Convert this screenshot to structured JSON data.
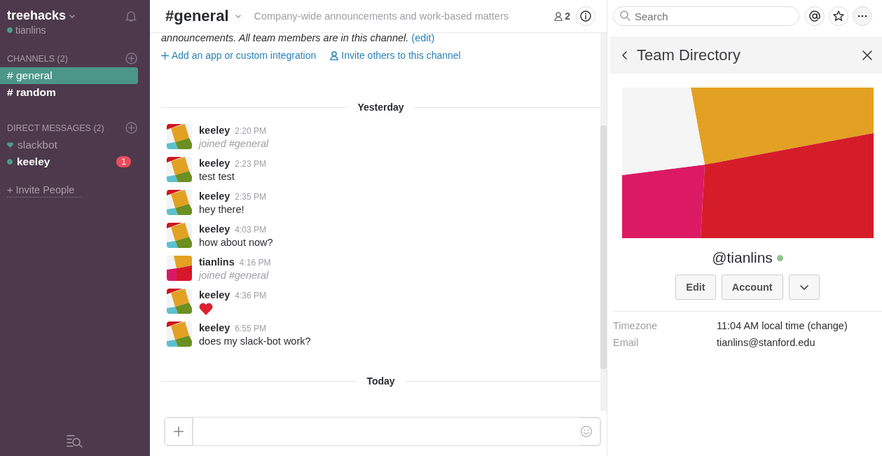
{
  "team": {
    "name": "treehacks",
    "user": "tianlins",
    "online": true
  },
  "channels_section": {
    "title": "CHANNELS",
    "count": "(2)"
  },
  "channels": [
    {
      "prefix": "#",
      "name": "general",
      "selected": true,
      "unread": false
    },
    {
      "prefix": "#",
      "name": "random",
      "selected": false,
      "unread": true
    }
  ],
  "dm_section": {
    "title": "DIRECT MESSAGES",
    "count": "(2)"
  },
  "direct_messages": [
    {
      "name": "slackbot",
      "kind": "bot",
      "unread": false
    },
    {
      "name": "keeley",
      "kind": "user",
      "unread": true,
      "badge": "1"
    }
  ],
  "invite": {
    "icon": "+",
    "label": "Invite People"
  },
  "header": {
    "channel": "#general",
    "topic": "Company-wide announcements and work-based matters",
    "members": "2",
    "search_placeholder": "Search"
  },
  "intro": {
    "text": "announcements. All team members are in this channel.",
    "edit": "(edit)"
  },
  "actions": [
    {
      "kind": "add",
      "label": "Add an app or custom integration"
    },
    {
      "kind": "invite",
      "label": "Invite others to this channel"
    }
  ],
  "dividers": [
    "Yesterday",
    "Today"
  ],
  "messages": [
    {
      "author": "keeley",
      "time": "2:20 PM",
      "kind": "joined",
      "text": "joined #general",
      "avatar": {
        "kind": "tilted"
      }
    },
    {
      "author": "keeley",
      "time": "2:23 PM",
      "kind": "text",
      "text": "test test",
      "avatar": {
        "kind": "tilted"
      }
    },
    {
      "author": "keeley",
      "time": "2:35 PM",
      "kind": "text",
      "text": "hey there!",
      "avatar": {
        "kind": "tilted"
      }
    },
    {
      "author": "keeley",
      "time": "4:03 PM",
      "kind": "text",
      "text": "how about now?",
      "avatar": {
        "kind": "tilted"
      }
    },
    {
      "author": "tianlins",
      "time": "4:16 PM",
      "kind": "joined",
      "text": "joined #general",
      "avatar": {
        "kind": "blocks"
      }
    },
    {
      "author": "keeley",
      "time": "4:36 PM",
      "kind": "heart",
      "avatar": {
        "kind": "tilted"
      }
    },
    {
      "author": "keeley",
      "time": "6:55 PM",
      "kind": "text",
      "text": "does my slack-bot work?",
      "avatar": {
        "kind": "tilted"
      }
    }
  ],
  "panel": {
    "title": "Team Directory",
    "handle": "@tianlins",
    "online": true,
    "buttons": [
      "Edit",
      "Account"
    ],
    "fields": [
      {
        "label": "Timezone",
        "value": "11:04 AM local time (change)"
      },
      {
        "label": "Email",
        "value": "tianlins@stanford.edu"
      }
    ]
  }
}
